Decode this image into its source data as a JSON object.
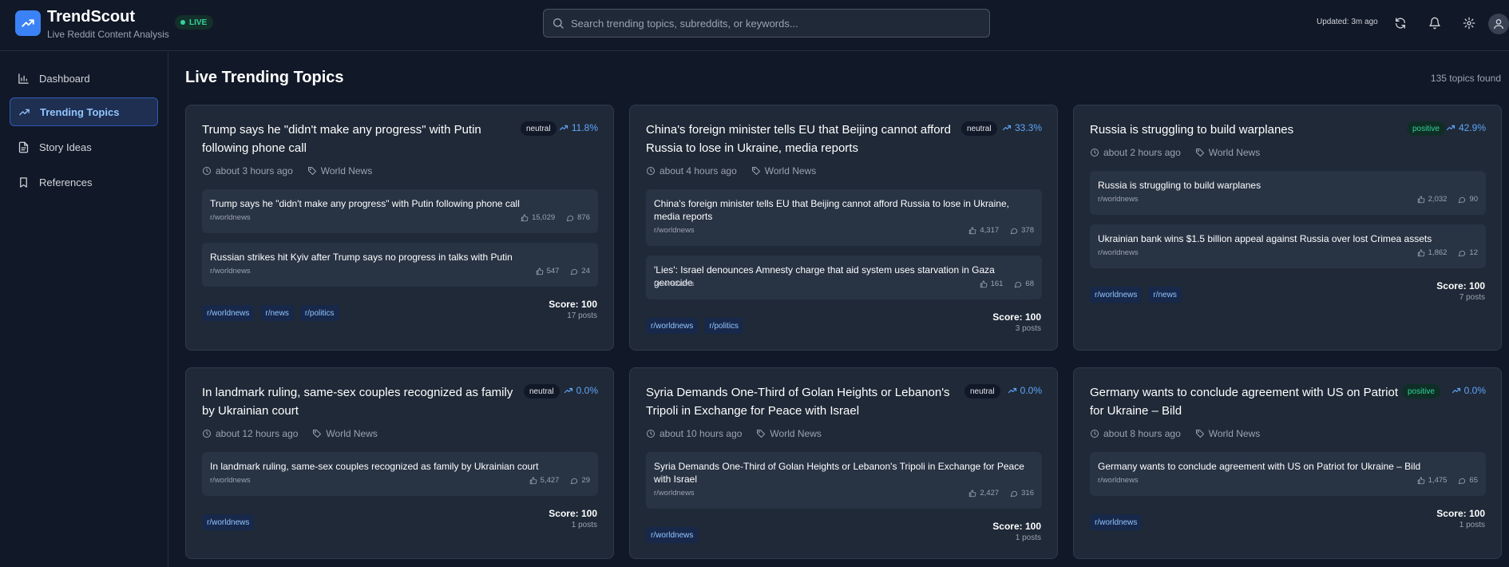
{
  "app": {
    "name": "TrendScout",
    "subtitle": "Live Reddit Content Analysis",
    "live_label": "LIVE",
    "updated": "Updated: 3m ago",
    "accent": "#3b82f6"
  },
  "search": {
    "placeholder": "Search trending topics, subreddits, or keywords..."
  },
  "sidebar": {
    "items": [
      {
        "label": "Dashboard",
        "icon": "bar-chart-icon"
      },
      {
        "label": "Trending Topics",
        "icon": "trending-up-icon",
        "active": true
      },
      {
        "label": "Story Ideas",
        "icon": "document-icon"
      },
      {
        "label": "References",
        "icon": "bookmark-icon"
      }
    ]
  },
  "main": {
    "title": "Live Trending Topics",
    "topics_found": "135 topics found",
    "cards": [
      {
        "title": "Trump says he \"didn't make any progress\" with Putin following phone call",
        "sentiment": "neutral",
        "trend": "11.8%",
        "time": "about 3 hours ago",
        "category": "World News",
        "posts": [
          {
            "title": "Trump says he \"didn't make any progress\" with Putin following phone call",
            "subreddit": "r/worldnews",
            "upvotes": "15,029",
            "comments": "876"
          },
          {
            "title": "Russian strikes hit Kyiv after Trump says no progress in talks with Putin",
            "subreddit": "r/worldnews",
            "upvotes": "547",
            "comments": "24"
          }
        ],
        "tags": [
          "r/worldnews",
          "r/news",
          "r/politics"
        ],
        "score": "Score: 100",
        "post_count": "17 posts"
      },
      {
        "title": "China's foreign minister tells EU that Beijing cannot afford Russia to lose in Ukraine, media reports",
        "sentiment": "neutral",
        "trend": "33.3%",
        "time": "about 4 hours ago",
        "category": "World News",
        "posts": [
          {
            "title": "China's foreign minister tells EU that Beijing cannot afford Russia to lose in Ukraine, media reports",
            "subreddit": "r/worldnews",
            "upvotes": "4,317",
            "comments": "378"
          },
          {
            "title": "'Lies': Israel denounces Amnesty charge that aid system uses starvation in Gaza genocide",
            "subreddit": "r/worldnews",
            "upvotes": "161",
            "comments": "68"
          }
        ],
        "tags": [
          "r/worldnews",
          "r/politics"
        ],
        "score": "Score: 100",
        "post_count": "3 posts"
      },
      {
        "title": "Russia is struggling to build warplanes",
        "sentiment": "positive",
        "trend": "42.9%",
        "time": "about 2 hours ago",
        "category": "World News",
        "posts": [
          {
            "title": "Russia is struggling to build warplanes",
            "subreddit": "r/worldnews",
            "upvotes": "2,032",
            "comments": "90"
          },
          {
            "title": "Ukrainian bank wins $1.5 billion appeal against Russia over lost Crimea assets",
            "subreddit": "r/worldnews",
            "upvotes": "1,862",
            "comments": "12"
          }
        ],
        "tags": [
          "r/worldnews",
          "r/news"
        ],
        "score": "Score: 100",
        "post_count": "7 posts"
      },
      {
        "title": "In landmark ruling, same-sex couples recognized as family by Ukrainian court",
        "sentiment": "neutral",
        "trend": "0.0%",
        "time": "about 12 hours ago",
        "category": "World News",
        "posts": [
          {
            "title": "In landmark ruling, same-sex couples recognized as family by Ukrainian court",
            "subreddit": "r/worldnews",
            "upvotes": "5,427",
            "comments": "29"
          }
        ],
        "tags": [
          "r/worldnews"
        ],
        "score": "Score: 100",
        "post_count": "1 posts"
      },
      {
        "title": "Syria Demands One-Third of Golan Heights or Lebanon's Tripoli in Exchange for Peace with Israel",
        "sentiment": "neutral",
        "trend": "0.0%",
        "time": "about 10 hours ago",
        "category": "World News",
        "posts": [
          {
            "title": "Syria Demands One-Third of Golan Heights or Lebanon's Tripoli in Exchange for Peace with Israel",
            "subreddit": "r/worldnews",
            "upvotes": "2,427",
            "comments": "316"
          }
        ],
        "tags": [
          "r/worldnews"
        ],
        "score": "Score: 100",
        "post_count": "1 posts"
      },
      {
        "title": "Germany wants to conclude agreement with US on Patriot for Ukraine – Bild",
        "sentiment": "positive",
        "trend": "0.0%",
        "time": "about 8 hours ago",
        "category": "World News",
        "posts": [
          {
            "title": "Germany wants to conclude agreement with US on Patriot for Ukraine – Bild",
            "subreddit": "r/worldnews",
            "upvotes": "1,475",
            "comments": "65"
          }
        ],
        "tags": [
          "r/worldnews"
        ],
        "score": "Score: 100",
        "post_count": "1 posts"
      }
    ]
  }
}
